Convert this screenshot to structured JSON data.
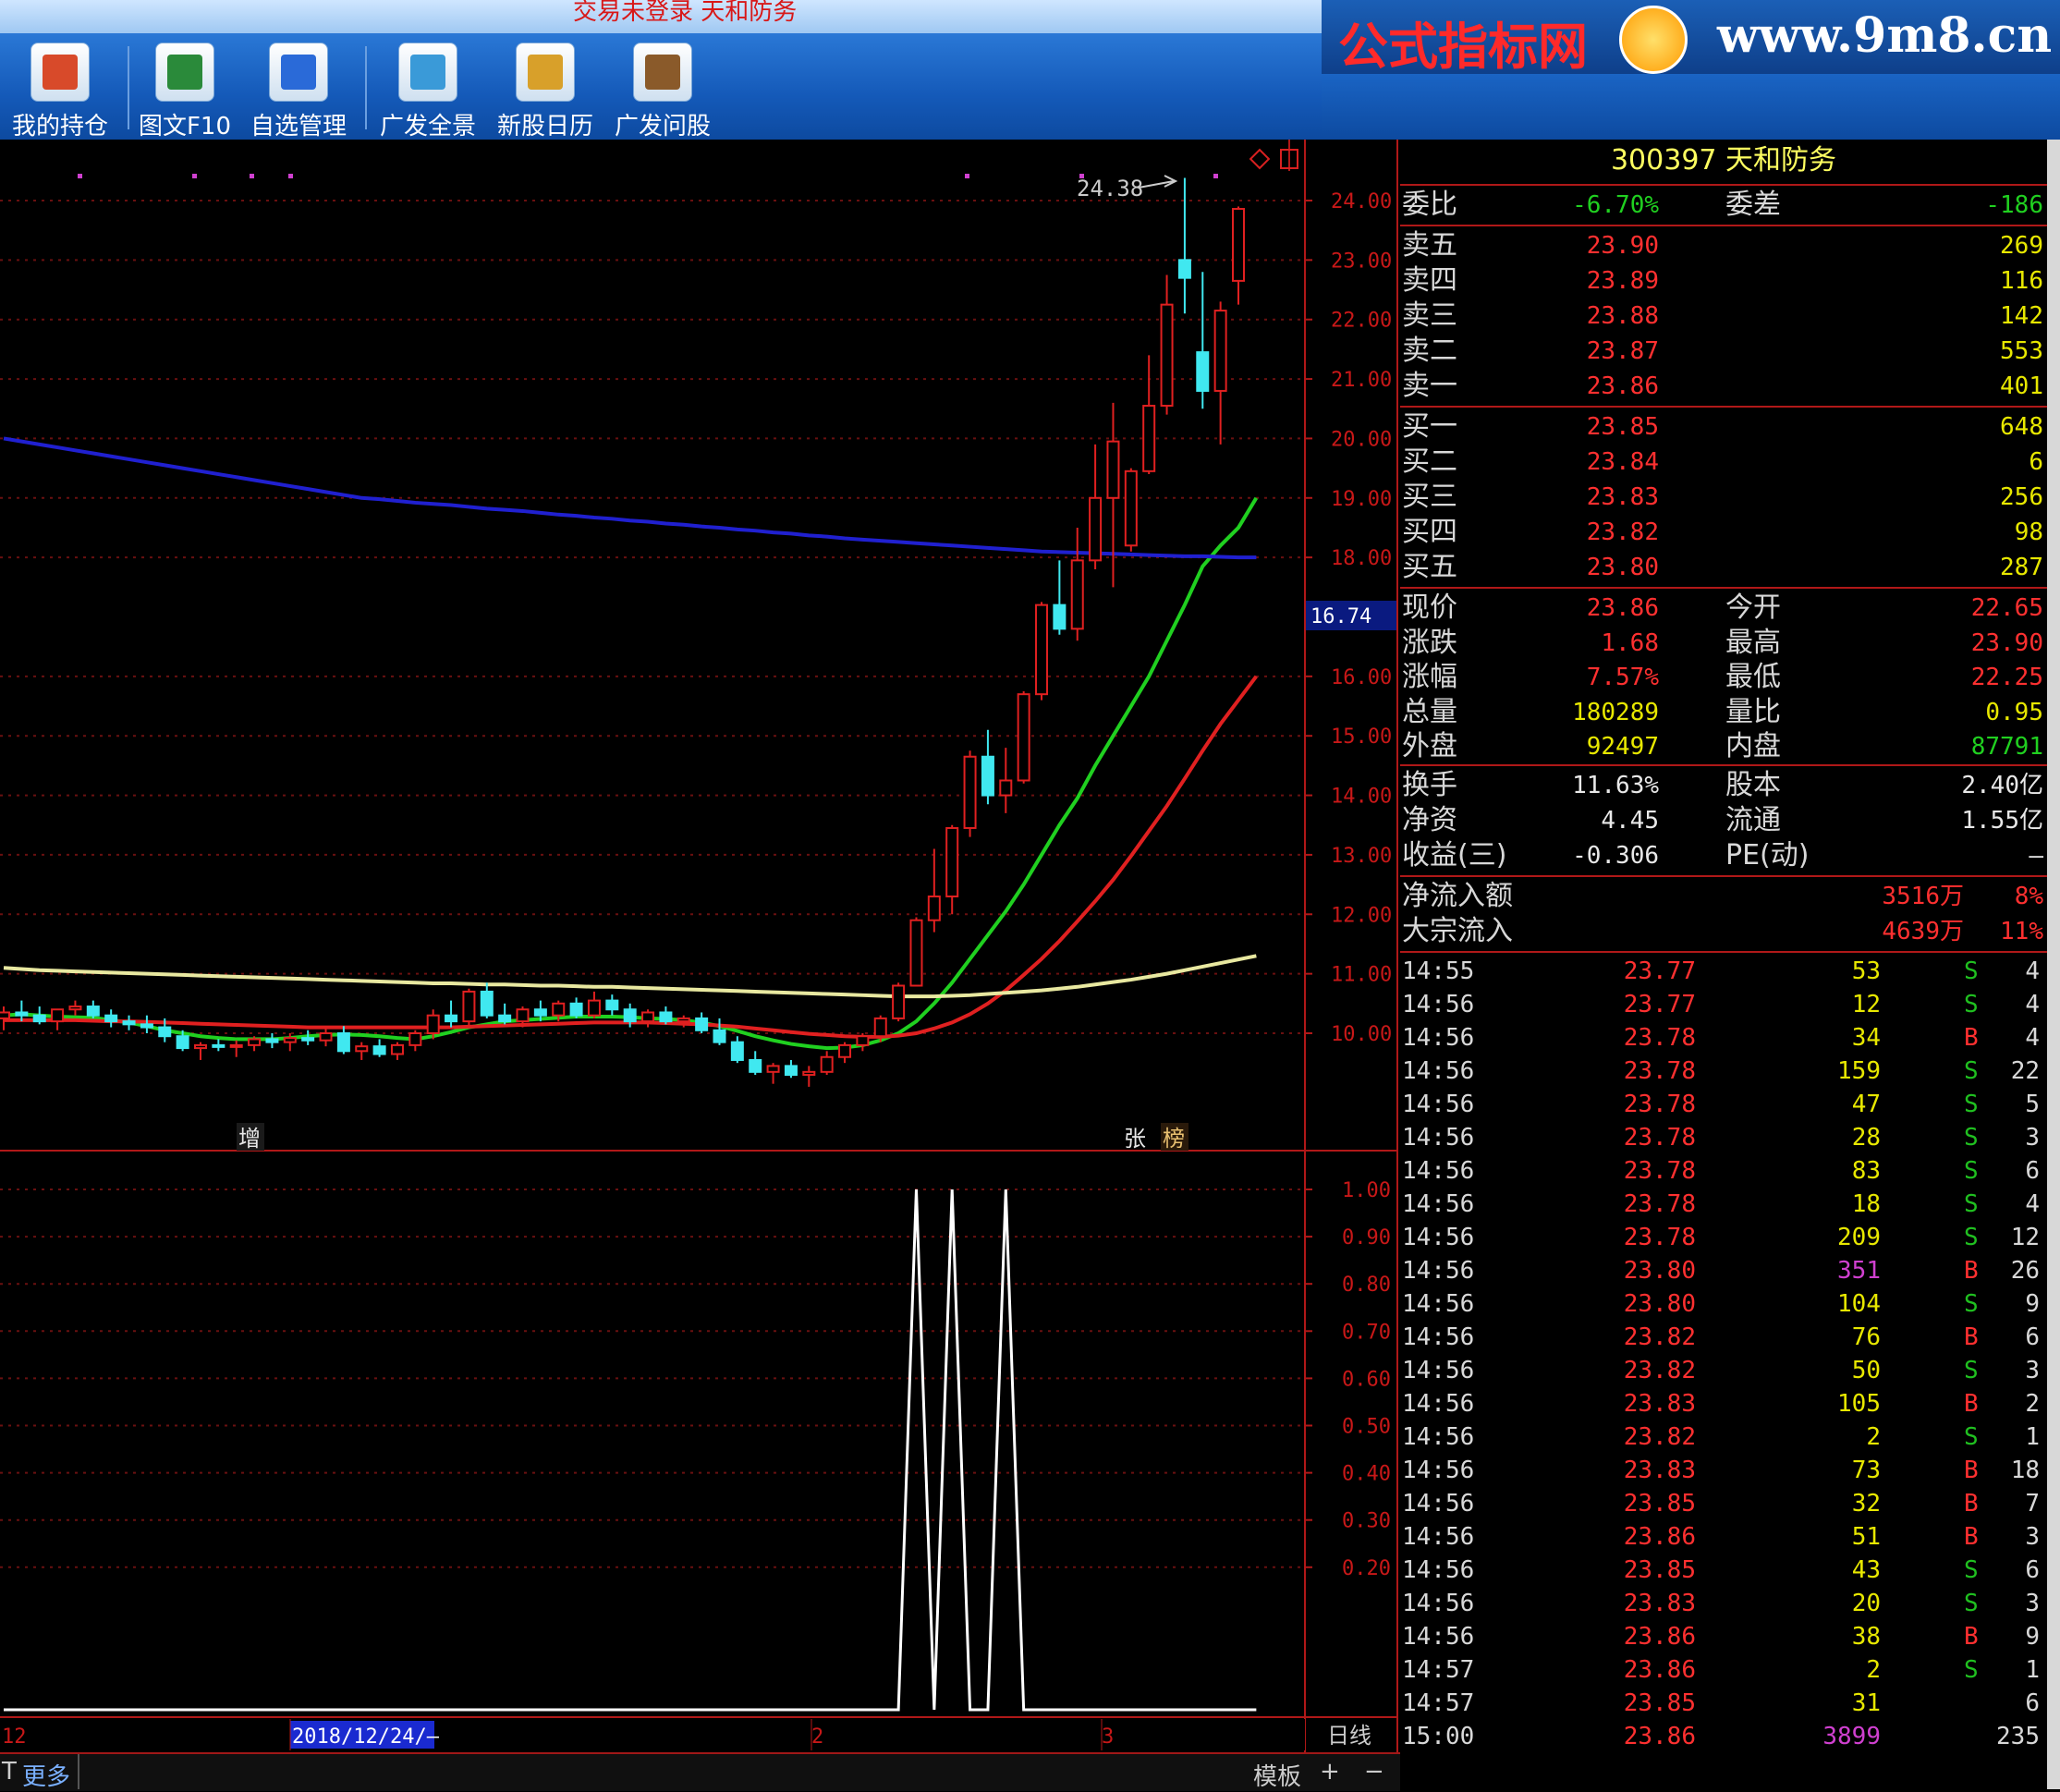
{
  "window": {
    "title": "交易未登录 天和防务"
  },
  "toolbar": {
    "buttons": [
      {
        "label": "我的持仓",
        "icon": "portfolio-icon",
        "color": "#d84a2a"
      },
      {
        "label": "图文F10",
        "icon": "f10-chart-icon",
        "color": "#2a8a3a"
      },
      {
        "label": "自选管理",
        "icon": "watchlist-icon",
        "color": "#2a6ad8"
      },
      {
        "label": "广发全景",
        "icon": "panorama-icon",
        "color": "#3a9ad8"
      },
      {
        "label": "新股日历",
        "icon": "calendar-icon",
        "color": "#d8a02a"
      },
      {
        "label": "广发问股",
        "icon": "ask-icon",
        "color": "#8a5a2a"
      }
    ]
  },
  "logo": {
    "name": "公式指标网",
    "url": "www.9m8.cn"
  },
  "chart": {
    "price_axis": [
      "24.00",
      "23.00",
      "22.00",
      "21.00",
      "20.00",
      "19.00",
      "18.00",
      "16.00",
      "15.00",
      "14.00",
      "13.00",
      "12.00",
      "11.00",
      "10.00"
    ],
    "current_marker": "16.74",
    "high_annotation": "24.38",
    "indicator_axis": [
      "1.00",
      "0.90",
      "0.80",
      "0.70",
      "0.60",
      "0.50",
      "0.40",
      "0.30",
      "0.20"
    ],
    "markers": {
      "zeng": "增",
      "zhang": "张",
      "bang": "榜"
    },
    "date_axis": {
      "left": "12",
      "selected": "2018/12/24/—",
      "m2": "2",
      "m3": "3"
    },
    "period": "日线"
  },
  "chart_data": {
    "type": "candlestick",
    "title": "300397 天和防务",
    "candles": [
      {
        "o": 10.25,
        "h": 10.45,
        "l": 10.05,
        "c": 10.35
      },
      {
        "o": 10.35,
        "h": 10.55,
        "l": 10.2,
        "c": 10.3
      },
      {
        "o": 10.3,
        "h": 10.45,
        "l": 10.15,
        "c": 10.2
      },
      {
        "o": 10.2,
        "h": 10.35,
        "l": 10.05,
        "c": 10.4
      },
      {
        "o": 10.4,
        "h": 10.55,
        "l": 10.3,
        "c": 10.45
      },
      {
        "o": 10.45,
        "h": 10.55,
        "l": 10.25,
        "c": 10.3
      },
      {
        "o": 10.3,
        "h": 10.4,
        "l": 10.1,
        "c": 10.2
      },
      {
        "o": 10.2,
        "h": 10.3,
        "l": 10.05,
        "c": 10.15
      },
      {
        "o": 10.15,
        "h": 10.3,
        "l": 10.0,
        "c": 10.1
      },
      {
        "o": 10.1,
        "h": 10.25,
        "l": 9.85,
        "c": 9.95
      },
      {
        "o": 9.95,
        "h": 10.05,
        "l": 9.7,
        "c": 9.75
      },
      {
        "o": 9.75,
        "h": 9.85,
        "l": 9.55,
        "c": 9.8
      },
      {
        "o": 9.8,
        "h": 9.9,
        "l": 9.7,
        "c": 9.78
      },
      {
        "o": 9.78,
        "h": 9.88,
        "l": 9.6,
        "c": 9.8
      },
      {
        "o": 9.8,
        "h": 9.95,
        "l": 9.7,
        "c": 9.9
      },
      {
        "o": 9.9,
        "h": 10.0,
        "l": 9.75,
        "c": 9.85
      },
      {
        "o": 9.85,
        "h": 10.0,
        "l": 9.7,
        "c": 9.92
      },
      {
        "o": 9.92,
        "h": 10.05,
        "l": 9.8,
        "c": 9.88
      },
      {
        "o": 9.88,
        "h": 10.1,
        "l": 9.78,
        "c": 10.0
      },
      {
        "o": 10.0,
        "h": 10.12,
        "l": 9.65,
        "c": 9.7
      },
      {
        "o": 9.7,
        "h": 9.85,
        "l": 9.55,
        "c": 9.78
      },
      {
        "o": 9.78,
        "h": 9.9,
        "l": 9.6,
        "c": 9.65
      },
      {
        "o": 9.65,
        "h": 9.85,
        "l": 9.55,
        "c": 9.8
      },
      {
        "o": 9.8,
        "h": 10.05,
        "l": 9.7,
        "c": 10.0
      },
      {
        "o": 10.0,
        "h": 10.4,
        "l": 9.9,
        "c": 10.3
      },
      {
        "o": 10.3,
        "h": 10.55,
        "l": 10.1,
        "c": 10.2
      },
      {
        "o": 10.2,
        "h": 10.75,
        "l": 10.1,
        "c": 10.7
      },
      {
        "o": 10.7,
        "h": 10.85,
        "l": 10.25,
        "c": 10.3
      },
      {
        "o": 10.3,
        "h": 10.5,
        "l": 10.15,
        "c": 10.2
      },
      {
        "o": 10.2,
        "h": 10.45,
        "l": 10.1,
        "c": 10.4
      },
      {
        "o": 10.4,
        "h": 10.55,
        "l": 10.2,
        "c": 10.3
      },
      {
        "o": 10.3,
        "h": 10.55,
        "l": 10.2,
        "c": 10.5
      },
      {
        "o": 10.5,
        "h": 10.6,
        "l": 10.25,
        "c": 10.3
      },
      {
        "o": 10.3,
        "h": 10.7,
        "l": 10.25,
        "c": 10.55
      },
      {
        "o": 10.55,
        "h": 10.65,
        "l": 10.3,
        "c": 10.4
      },
      {
        "o": 10.4,
        "h": 10.5,
        "l": 10.1,
        "c": 10.2
      },
      {
        "o": 10.2,
        "h": 10.4,
        "l": 10.1,
        "c": 10.35
      },
      {
        "o": 10.35,
        "h": 10.45,
        "l": 10.15,
        "c": 10.2
      },
      {
        "o": 10.2,
        "h": 10.3,
        "l": 10.1,
        "c": 10.25
      },
      {
        "o": 10.25,
        "h": 10.35,
        "l": 10.0,
        "c": 10.05
      },
      {
        "o": 10.05,
        "h": 10.25,
        "l": 9.8,
        "c": 9.85
      },
      {
        "o": 9.85,
        "h": 9.95,
        "l": 9.5,
        "c": 9.55
      },
      {
        "o": 9.55,
        "h": 9.7,
        "l": 9.3,
        "c": 9.35
      },
      {
        "o": 9.35,
        "h": 9.5,
        "l": 9.15,
        "c": 9.45
      },
      {
        "o": 9.45,
        "h": 9.55,
        "l": 9.25,
        "c": 9.3
      },
      {
        "o": 9.3,
        "h": 9.45,
        "l": 9.1,
        "c": 9.35
      },
      {
        "o": 9.35,
        "h": 9.7,
        "l": 9.3,
        "c": 9.6
      },
      {
        "o": 9.6,
        "h": 9.85,
        "l": 9.5,
        "c": 9.8
      },
      {
        "o": 9.8,
        "h": 10.0,
        "l": 9.7,
        "c": 9.95
      },
      {
        "o": 9.95,
        "h": 10.3,
        "l": 9.85,
        "c": 10.25
      },
      {
        "o": 10.25,
        "h": 10.85,
        "l": 10.2,
        "c": 10.8
      },
      {
        "o": 10.8,
        "h": 11.95,
        "l": 10.8,
        "c": 11.9
      },
      {
        "o": 11.9,
        "h": 13.1,
        "l": 11.7,
        "c": 12.3
      },
      {
        "o": 12.3,
        "h": 13.5,
        "l": 12.0,
        "c": 13.45
      },
      {
        "o": 13.45,
        "h": 14.75,
        "l": 13.3,
        "c": 14.65
      },
      {
        "o": 14.65,
        "h": 15.1,
        "l": 13.85,
        "c": 14.0
      },
      {
        "o": 14.0,
        "h": 14.8,
        "l": 13.7,
        "c": 14.25
      },
      {
        "o": 14.25,
        "h": 15.75,
        "l": 14.2,
        "c": 15.7
      },
      {
        "o": 15.7,
        "h": 17.25,
        "l": 15.6,
        "c": 17.2
      },
      {
        "o": 17.2,
        "h": 17.95,
        "l": 16.7,
        "c": 16.8
      },
      {
        "o": 16.8,
        "h": 18.5,
        "l": 16.6,
        "c": 17.95
      },
      {
        "o": 17.95,
        "h": 19.9,
        "l": 17.8,
        "c": 19.0
      },
      {
        "o": 19.0,
        "h": 20.6,
        "l": 17.5,
        "c": 19.95
      },
      {
        "o": 18.2,
        "h": 19.5,
        "l": 18.1,
        "c": 19.45
      },
      {
        "o": 19.45,
        "h": 21.4,
        "l": 19.4,
        "c": 20.55
      },
      {
        "o": 20.55,
        "h": 22.75,
        "l": 20.4,
        "c": 22.25
      },
      {
        "o": 23.0,
        "h": 24.38,
        "l": 22.1,
        "c": 22.7
      },
      {
        "o": 21.45,
        "h": 22.8,
        "l": 20.5,
        "c": 20.8
      },
      {
        "o": 20.8,
        "h": 22.3,
        "l": 19.9,
        "c": 22.15
      },
      {
        "o": 22.65,
        "h": 23.9,
        "l": 22.25,
        "c": 23.86
      }
    ],
    "ma_series": [
      {
        "name": "MA-green",
        "color": "#20d020",
        "values": [
          10.3,
          10.32,
          10.3,
          10.28,
          10.27,
          10.26,
          10.22,
          10.18,
          10.12,
          10.05,
          10.0,
          9.95,
          9.92,
          9.9,
          9.9,
          9.9,
          9.92,
          9.95,
          9.97,
          9.98,
          9.97,
          9.95,
          9.92,
          9.9,
          9.95,
          10.02,
          10.1,
          10.15,
          10.2,
          10.22,
          10.24,
          10.26,
          10.28,
          10.28,
          10.28,
          10.27,
          10.25,
          10.24,
          10.22,
          10.18,
          10.12,
          10.04,
          9.95,
          9.88,
          9.82,
          9.78,
          9.75,
          9.76,
          9.8,
          9.88,
          10.0,
          10.2,
          10.5,
          10.85,
          11.25,
          11.65,
          12.05,
          12.5,
          13.0,
          13.5,
          13.95,
          14.5,
          15.0,
          15.5,
          16.0,
          16.6,
          17.2,
          17.85,
          18.2,
          18.5,
          19.0
        ]
      },
      {
        "name": "MA-red",
        "color": "#e02020",
        "values": [
          10.22,
          10.22,
          10.22,
          10.22,
          10.22,
          10.21,
          10.2,
          10.2,
          10.19,
          10.18,
          10.17,
          10.16,
          10.15,
          10.14,
          10.13,
          10.12,
          10.11,
          10.1,
          10.1,
          10.1,
          10.1,
          10.1,
          10.1,
          10.1,
          10.1,
          10.1,
          10.11,
          10.12,
          10.13,
          10.14,
          10.15,
          10.16,
          10.17,
          10.18,
          10.18,
          10.18,
          10.18,
          10.17,
          10.16,
          10.15,
          10.13,
          10.11,
          10.08,
          10.05,
          10.02,
          9.99,
          9.97,
          9.95,
          9.94,
          9.94,
          9.96,
          10.0,
          10.08,
          10.18,
          10.32,
          10.5,
          10.72,
          10.98,
          11.25,
          11.55,
          11.88,
          12.22,
          12.58,
          12.98,
          13.4,
          13.82,
          14.28,
          14.75,
          15.2,
          15.6,
          16.0
        ]
      },
      {
        "name": "MA-yellow",
        "color": "#e8e8a0",
        "values": [
          11.1,
          11.08,
          11.06,
          11.05,
          11.04,
          11.03,
          11.02,
          11.01,
          11.0,
          10.99,
          10.98,
          10.97,
          10.96,
          10.95,
          10.94,
          10.93,
          10.92,
          10.91,
          10.9,
          10.89,
          10.88,
          10.87,
          10.86,
          10.85,
          10.84,
          10.84,
          10.83,
          10.82,
          10.82,
          10.81,
          10.8,
          10.8,
          10.79,
          10.78,
          10.78,
          10.77,
          10.76,
          10.75,
          10.74,
          10.73,
          10.72,
          10.71,
          10.7,
          10.69,
          10.68,
          10.67,
          10.66,
          10.65,
          10.64,
          10.63,
          10.62,
          10.62,
          10.62,
          10.63,
          10.64,
          10.66,
          10.68,
          10.7,
          10.72,
          10.75,
          10.78,
          10.82,
          10.86,
          10.9,
          10.95,
          11.0,
          11.06,
          11.12,
          11.18,
          11.24,
          11.3
        ]
      },
      {
        "name": "MA-blue",
        "color": "#2020d0",
        "values": [
          20.0,
          19.95,
          19.9,
          19.85,
          19.8,
          19.75,
          19.7,
          19.65,
          19.6,
          19.55,
          19.5,
          19.45,
          19.4,
          19.35,
          19.3,
          19.25,
          19.2,
          19.15,
          19.1,
          19.05,
          19.0,
          18.98,
          18.95,
          18.92,
          18.9,
          18.88,
          18.85,
          18.82,
          18.8,
          18.78,
          18.75,
          18.72,
          18.7,
          18.67,
          18.65,
          18.62,
          18.6,
          18.57,
          18.55,
          18.52,
          18.5,
          18.47,
          18.45,
          18.42,
          18.4,
          18.37,
          18.35,
          18.32,
          18.3,
          18.28,
          18.26,
          18.24,
          18.22,
          18.2,
          18.18,
          18.16,
          18.14,
          18.12,
          18.1,
          18.09,
          18.08,
          18.07,
          18.06,
          18.05,
          18.04,
          18.03,
          18.02,
          18.02,
          18.01,
          18.0,
          18.0
        ]
      }
    ],
    "indicator": {
      "color": "#ffffff",
      "values": [
        0,
        0,
        0,
        0,
        0,
        0,
        0,
        0,
        0,
        0,
        0,
        0,
        0,
        0,
        0,
        0,
        0,
        0,
        0,
        0,
        0,
        0,
        0,
        0,
        0,
        0,
        0,
        0,
        0,
        0,
        0,
        0,
        0,
        0,
        0,
        0,
        0,
        0,
        0,
        0,
        0,
        0,
        0,
        0,
        0,
        0,
        0,
        0,
        0,
        0,
        0,
        1,
        0,
        1,
        0,
        0,
        1,
        0,
        0,
        0,
        0,
        0,
        0,
        0,
        0,
        0,
        0,
        0,
        0,
        0,
        0
      ]
    },
    "ylim": [
      9.0,
      24.5
    ],
    "indicator_ylim": [
      0.0,
      1.0
    ]
  },
  "quote": {
    "header": "300397 天和防务",
    "weibi": {
      "label": "委比",
      "value": "-6.70%",
      "label2": "委差",
      "value2": "-186"
    },
    "sells": [
      {
        "label": "卖五",
        "price": "23.90",
        "vol": "269"
      },
      {
        "label": "卖四",
        "price": "23.89",
        "vol": "116"
      },
      {
        "label": "卖三",
        "price": "23.88",
        "vol": "142"
      },
      {
        "label": "卖二",
        "price": "23.87",
        "vol": "553"
      },
      {
        "label": "卖一",
        "price": "23.86",
        "vol": "401"
      }
    ],
    "buys": [
      {
        "label": "买一",
        "price": "23.85",
        "vol": "648"
      },
      {
        "label": "买二",
        "price": "23.84",
        "vol": "6"
      },
      {
        "label": "买三",
        "price": "23.83",
        "vol": "256"
      },
      {
        "label": "买四",
        "price": "23.82",
        "vol": "98"
      },
      {
        "label": "买五",
        "price": "23.80",
        "vol": "287"
      }
    ],
    "stats1": [
      {
        "l1": "现价",
        "v1": "23.86",
        "l2": "今开",
        "v2": "22.65"
      },
      {
        "l1": "涨跌",
        "v1": "1.68",
        "l2": "最高",
        "v2": "23.90"
      },
      {
        "l1": "涨幅",
        "v1": "7.57%",
        "l2": "最低",
        "v2": "22.25"
      },
      {
        "l1": "总量",
        "v1": "180289",
        "l2": "量比",
        "v2": "0.95"
      },
      {
        "l1": "外盘",
        "v1": "92497",
        "l2": "内盘",
        "v2": "87791"
      }
    ],
    "stats2": [
      {
        "l1": "换手",
        "v1": "11.63%",
        "l2": "股本",
        "v2": "2.40亿"
      },
      {
        "l1": "净资",
        "v1": "4.45",
        "l2": "流通",
        "v2": "1.55亿"
      },
      {
        "l1": "收益(三)",
        "v1": "-0.306",
        "l2": "PE(动)",
        "v2": "—"
      }
    ],
    "flow": [
      {
        "label": "净流入额",
        "value": "3516万",
        "pct": "8%"
      },
      {
        "label": "大宗流入",
        "value": "4639万",
        "pct": "11%"
      }
    ],
    "ticks": [
      {
        "t": "14:55",
        "p": "23.77",
        "v": "53",
        "bs": "S",
        "n": "4"
      },
      {
        "t": "14:56",
        "p": "23.77",
        "v": "12",
        "bs": "S",
        "n": "4"
      },
      {
        "t": "14:56",
        "p": "23.78",
        "v": "34",
        "bs": "B",
        "n": "4"
      },
      {
        "t": "14:56",
        "p": "23.78",
        "v": "159",
        "bs": "S",
        "n": "22"
      },
      {
        "t": "14:56",
        "p": "23.78",
        "v": "47",
        "bs": "S",
        "n": "5"
      },
      {
        "t": "14:56",
        "p": "23.78",
        "v": "28",
        "bs": "S",
        "n": "3"
      },
      {
        "t": "14:56",
        "p": "23.78",
        "v": "83",
        "bs": "S",
        "n": "6"
      },
      {
        "t": "14:56",
        "p": "23.78",
        "v": "18",
        "bs": "S",
        "n": "4"
      },
      {
        "t": "14:56",
        "p": "23.78",
        "v": "209",
        "bs": "S",
        "n": "12"
      },
      {
        "t": "14:56",
        "p": "23.80",
        "v": "351",
        "bs": "B",
        "n": "26"
      },
      {
        "t": "14:56",
        "p": "23.80",
        "v": "104",
        "bs": "S",
        "n": "9"
      },
      {
        "t": "14:56",
        "p": "23.82",
        "v": "76",
        "bs": "B",
        "n": "6"
      },
      {
        "t": "14:56",
        "p": "23.82",
        "v": "50",
        "bs": "S",
        "n": "3"
      },
      {
        "t": "14:56",
        "p": "23.83",
        "v": "105",
        "bs": "B",
        "n": "2"
      },
      {
        "t": "14:56",
        "p": "23.82",
        "v": "2",
        "bs": "S",
        "n": "1"
      },
      {
        "t": "14:56",
        "p": "23.83",
        "v": "73",
        "bs": "B",
        "n": "18"
      },
      {
        "t": "14:56",
        "p": "23.85",
        "v": "32",
        "bs": "B",
        "n": "7"
      },
      {
        "t": "14:56",
        "p": "23.86",
        "v": "51",
        "bs": "B",
        "n": "3"
      },
      {
        "t": "14:56",
        "p": "23.85",
        "v": "43",
        "bs": "S",
        "n": "6"
      },
      {
        "t": "14:56",
        "p": "23.83",
        "v": "20",
        "bs": "S",
        "n": "3"
      },
      {
        "t": "14:56",
        "p": "23.86",
        "v": "38",
        "bs": "B",
        "n": "9"
      },
      {
        "t": "14:57",
        "p": "23.86",
        "v": "2",
        "bs": "S",
        "n": "1"
      },
      {
        "t": "14:57",
        "p": "23.85",
        "v": "31",
        "bs": "",
        "n": "6"
      },
      {
        "t": "15:00",
        "p": "23.86",
        "v": "3899",
        "bs": "",
        "n": "235"
      }
    ]
  },
  "bottom": {
    "t": "T",
    "more": "更多",
    "template": "模板",
    "plus": "+",
    "minus": "−"
  },
  "colors": {
    "up": "#e02020",
    "down": "#40e8f0",
    "grid": "#7a1010",
    "panel_line": "#b01818"
  }
}
